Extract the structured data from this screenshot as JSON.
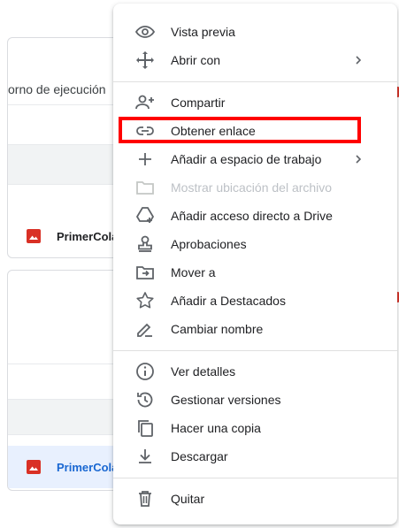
{
  "background": {
    "card1": {
      "title": "orno de ejecución",
      "file_name": "PrimerCola"
    },
    "card2": {
      "file_name": "PrimerCola"
    }
  },
  "menu": {
    "items": [
      {
        "label": "Vista previa",
        "icon": "eye-icon"
      },
      {
        "label": "Abrir con",
        "icon": "move-arrows-icon",
        "has_submenu": true
      },
      {
        "label": "Compartir",
        "icon": "add-person-icon"
      },
      {
        "label": "Obtener enlace",
        "icon": "link-icon",
        "highlighted": true
      },
      {
        "label": "Añadir a espacio de trabajo",
        "icon": "plus-icon",
        "has_submenu": true
      },
      {
        "label": "Mostrar ubicación del archivo",
        "icon": "folder-icon",
        "disabled": true
      },
      {
        "label": "Añadir acceso directo a Drive",
        "icon": "drive-shortcut-icon"
      },
      {
        "label": "Aprobaciones",
        "icon": "stamp-icon"
      },
      {
        "label": "Mover a",
        "icon": "move-to-folder-icon"
      },
      {
        "label": "Añadir a Destacados",
        "icon": "star-icon"
      },
      {
        "label": "Cambiar nombre",
        "icon": "pencil-icon"
      },
      {
        "label": "Ver detalles",
        "icon": "info-icon"
      },
      {
        "label": "Gestionar versiones",
        "icon": "history-icon"
      },
      {
        "label": "Hacer una copia",
        "icon": "copy-icon"
      },
      {
        "label": "Descargar",
        "icon": "download-icon"
      },
      {
        "label": "Quitar",
        "icon": "trash-icon"
      }
    ]
  },
  "colors": {
    "highlight_border": "#ff0000",
    "file_icon_red": "#d93025",
    "selected_row_bg": "#e8f0fe",
    "selected_text": "#1967d2",
    "icon_grey": "#5f6368",
    "disabled_text": "#bdc1c6"
  }
}
